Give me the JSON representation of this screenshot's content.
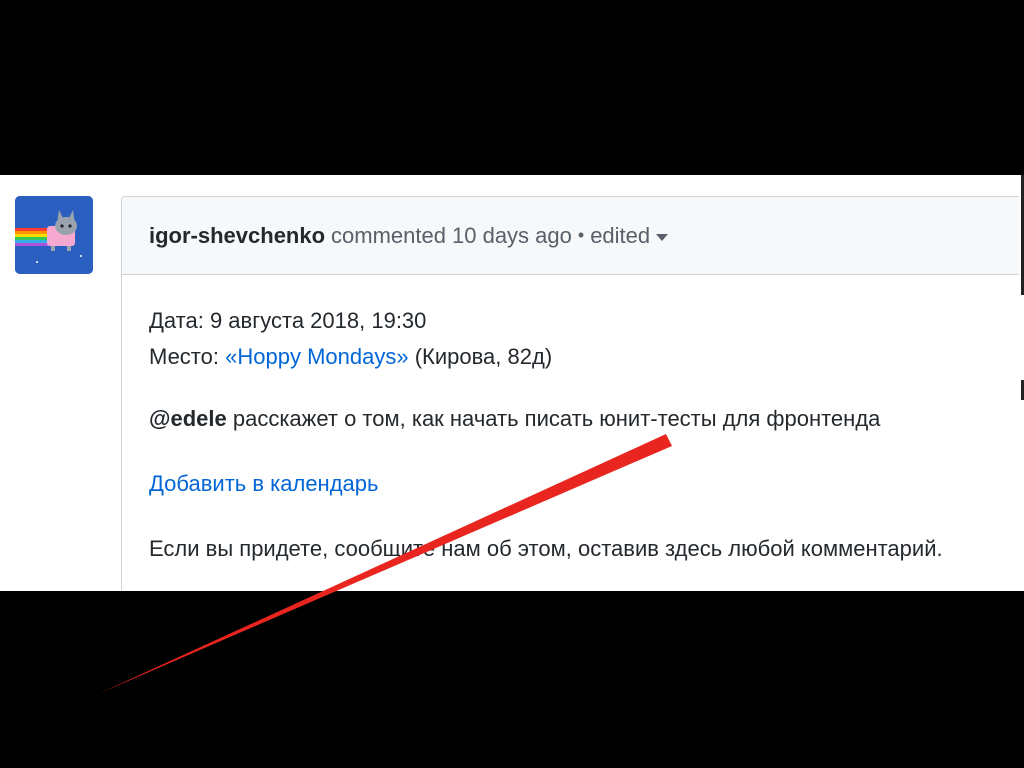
{
  "comment": {
    "author": "igor-shevchenko",
    "action": "commented",
    "time": "10 days ago",
    "separator": "•",
    "edited_label": "edited",
    "date_label": "Дата:",
    "date_value": "9 августа 2018, 19:30",
    "place_label": "Место:",
    "place_link": "«Hoppy Mondays»",
    "place_address": "(Кирова, 82д)",
    "mention": "@edele",
    "announcement": "расскажет о том, как начать писать юнит-тесты для фронтенда",
    "calendar_link": "Добавить в календарь",
    "footer_text": "Если вы придете, сообщите нам об этом, оставив здесь любой комментарий."
  },
  "colors": {
    "link": "#0366d6",
    "strike": "#e8251f",
    "avatar_bg": "#2a5fbf"
  },
  "icons": {
    "avatar": "octocat-nyan-avatar",
    "caret": "caret-down-icon"
  }
}
